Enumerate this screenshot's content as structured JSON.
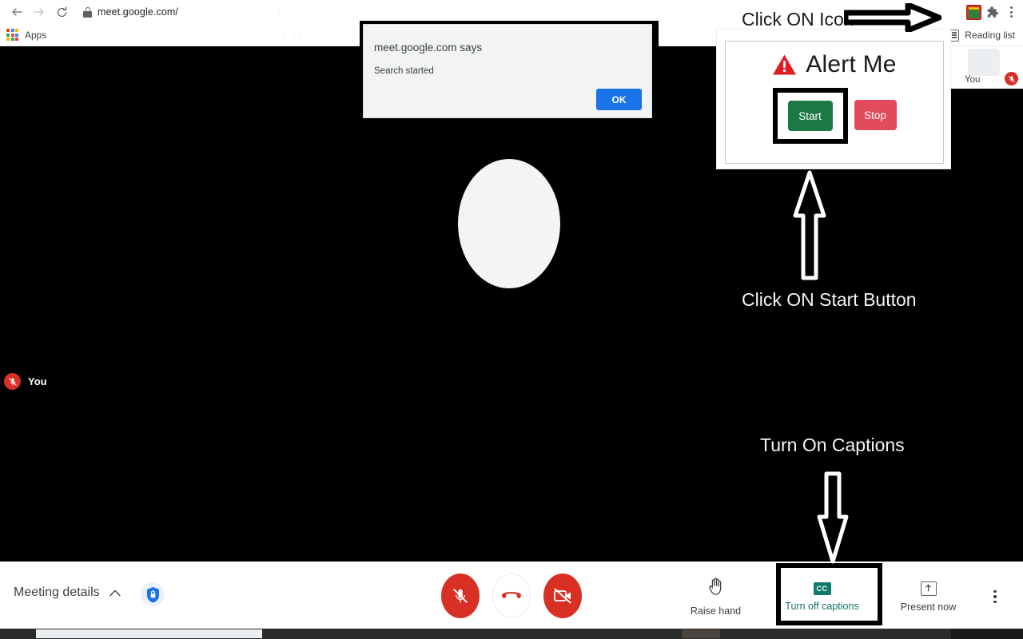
{
  "browser": {
    "back_icon": "back-arrow-icon",
    "forward_icon": "forward-arrow-icon",
    "reload_icon": "reload-icon",
    "url": "meet.google.com/",
    "lock_icon": "lock-icon",
    "apps_label": "Apps",
    "reading_list_label": "Reading list",
    "extension_icon_name": "alert-me-extension-icon",
    "puzzle_icon_name": "extensions-puzzle-icon",
    "menu_icon_name": "browser-kebab-menu-icon"
  },
  "js_dialog": {
    "title": "meet.google.com says",
    "message": "Search started",
    "ok_label": "OK"
  },
  "extension_popup": {
    "warning_icon": "warning-triangle-icon",
    "title": "Alert Me",
    "start_label": "Start",
    "stop_label": "Stop",
    "colors": {
      "start": "#1b7a46",
      "stop": "#e24b5c",
      "warning": "#e01b22"
    }
  },
  "annotations": {
    "click_icon": "Click ON Icon",
    "click_start": "Click ON Start Button",
    "turn_on_captions": "Turn On Captions",
    "right_arrow_icon": "right-arrow-annotation-icon",
    "up_arrow_icon": "up-arrow-annotation-icon",
    "down_arrow_icon": "down-arrow-annotation-icon"
  },
  "meet": {
    "self_tile_name": "You",
    "self_tile_mic_icon": "mic-off-icon",
    "participant_label": "You",
    "participant_mic_icon": "mic-off-icon",
    "avatar_name": "participant-avatar"
  },
  "bottom_bar": {
    "meeting_details_label": "Meeting details",
    "meeting_details_chevron": "chevron-up-icon",
    "shield_icon": "shield-lock-icon",
    "mic_button_icon": "mic-off-icon",
    "hangup_button_icon": "hang-up-phone-icon",
    "camera_button_icon": "camera-off-icon",
    "raise_hand_label": "Raise hand",
    "raise_hand_icon": "raise-hand-icon",
    "captions_label": "Turn off captions",
    "captions_icon": "closed-captions-icon",
    "captions_icon_text": "CC",
    "present_label": "Present now",
    "present_icon": "present-screen-icon",
    "more_options_icon": "more-options-kebab-icon",
    "accent_color": "#137367",
    "danger_color": "#d93025"
  }
}
